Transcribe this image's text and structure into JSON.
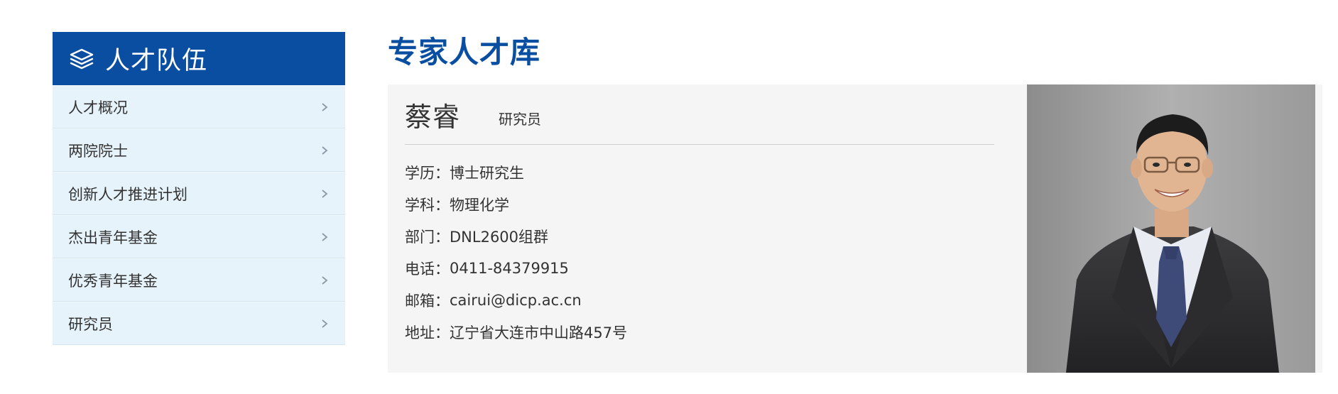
{
  "sidebar": {
    "icon": "layers-icon",
    "title": "人才队伍",
    "items": [
      {
        "label": "人才概况"
      },
      {
        "label": "两院院士"
      },
      {
        "label": "创新人才推进计划"
      },
      {
        "label": "杰出青年基金"
      },
      {
        "label": "优秀青年基金"
      },
      {
        "label": "研究员"
      }
    ]
  },
  "main": {
    "title": "专家人才库",
    "profile": {
      "name": "蔡睿",
      "position": "研究员",
      "fields": [
        {
          "label": "学历：",
          "value": "博士研究生"
        },
        {
          "label": "学科：",
          "value": "物理化学"
        },
        {
          "label": "部门：",
          "value": "DNL2600组群"
        },
        {
          "label": "电话：",
          "value": "0411-84379915"
        },
        {
          "label": "邮箱：",
          "value": "cairui@dicp.ac.cn"
        },
        {
          "label": "地址：",
          "value": "辽宁省大连市中山路457号"
        }
      ]
    }
  },
  "colors": {
    "brand_blue": "#0a4ea2",
    "sidebar_item_bg": "#e6f3fb",
    "card_bg": "#f5f5f5"
  }
}
